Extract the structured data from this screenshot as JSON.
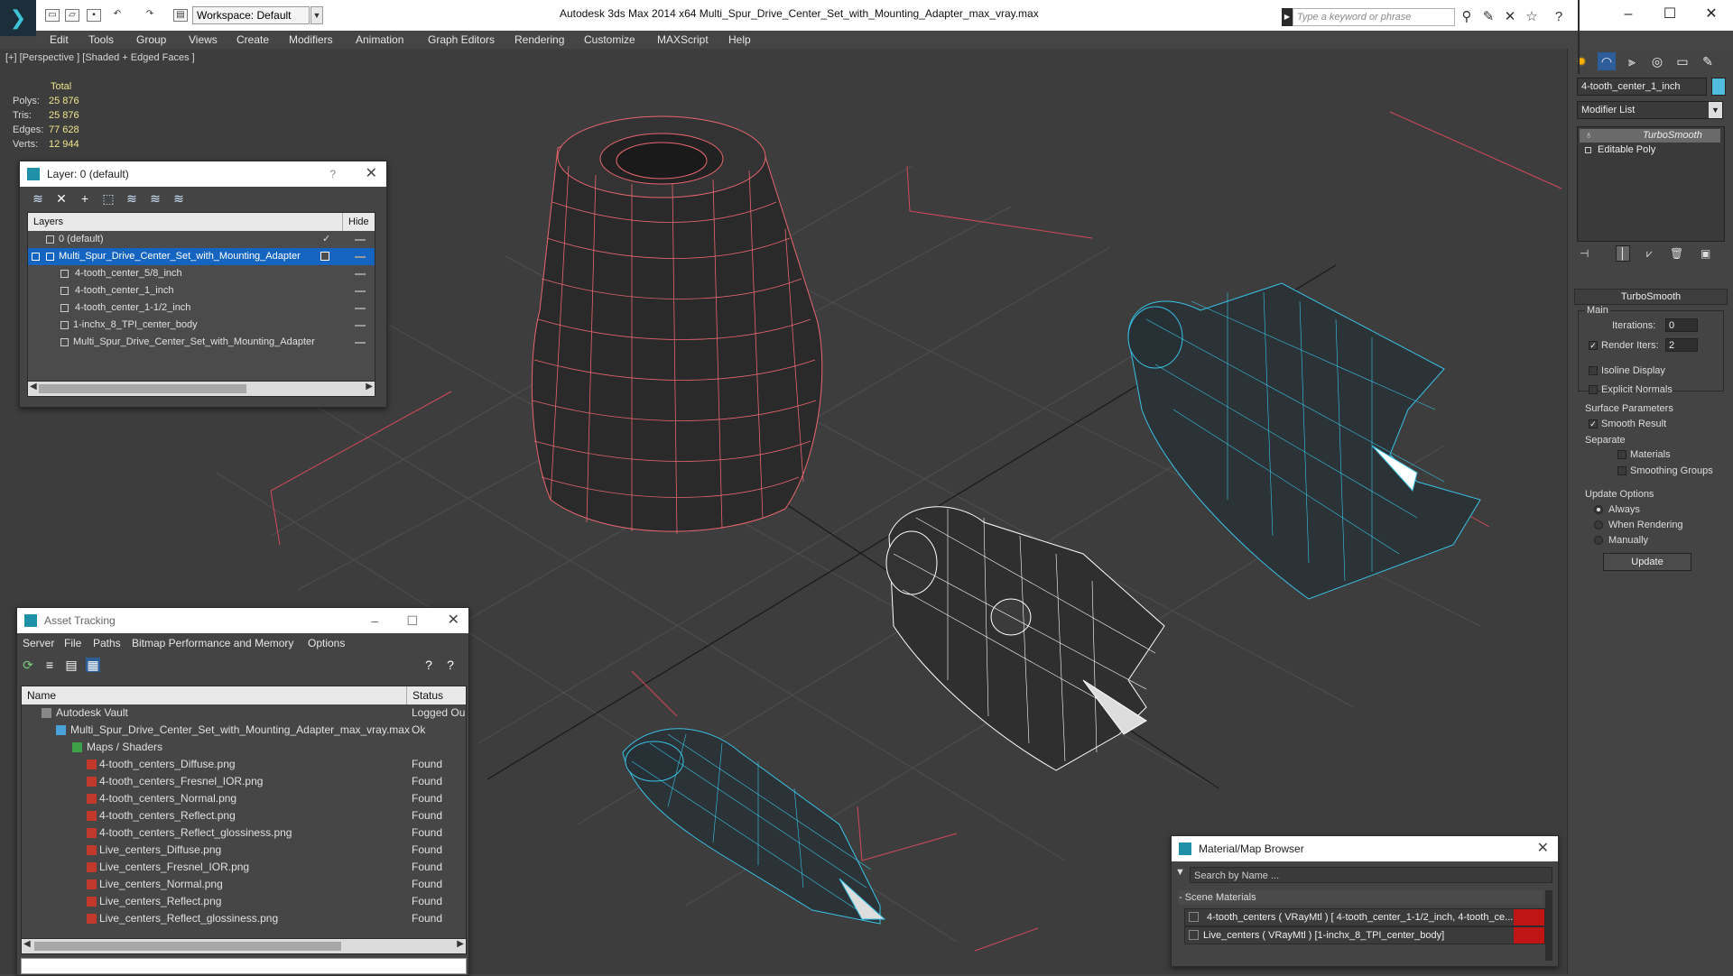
{
  "titlebar": {
    "workspace": "Workspace: Default",
    "title": "Autodesk 3ds Max  2014 x64     Multi_Spur_Drive_Center_Set_with_Mounting_Adapter_max_vray.max",
    "search_placeholder": "Type a keyword or phrase"
  },
  "menu": [
    "Edit",
    "Tools",
    "Group",
    "Views",
    "Create",
    "Modifiers",
    "Animation",
    "Graph Editors",
    "Rendering",
    "Customize",
    "MAXScript",
    "Help"
  ],
  "viewport": {
    "label": "[+] [Perspective ] [Shaded + Edged Faces ]",
    "stats": {
      "header": "Total",
      "rows": [
        {
          "label": "Polys:",
          "value": "25 876"
        },
        {
          "label": "Tris:",
          "value": "25 876"
        },
        {
          "label": "Edges:",
          "value": "77 628"
        },
        {
          "label": "Verts:",
          "value": "12 944"
        }
      ]
    }
  },
  "layer_dialog": {
    "title": "Layer: 0 (default)",
    "help": "?",
    "col_layers": "Layers",
    "col_hide": "Hide",
    "rows": [
      {
        "name": "0 (default)"
      },
      {
        "name": "Multi_Spur_Drive_Center_Set_with_Mounting_Adapter"
      },
      {
        "name": "4-tooth_center_5/8_inch"
      },
      {
        "name": "4-tooth_center_1_inch"
      },
      {
        "name": "4-tooth_center_1-1/2_inch"
      },
      {
        "name": "1-inchx_8_TPI_center_body"
      },
      {
        "name": "Multi_Spur_Drive_Center_Set_with_Mounting_Adapter"
      }
    ]
  },
  "asset_dialog": {
    "title": "Asset Tracking",
    "menu": [
      "Server",
      "File",
      "Paths",
      "Bitmap Performance and Memory",
      "Options"
    ],
    "col_name": "Name",
    "col_status": "Status",
    "rows": [
      {
        "name": "Autodesk Vault",
        "status": "Logged Ou"
      },
      {
        "name": "Multi_Spur_Drive_Center_Set_with_Mounting_Adapter_max_vray.max",
        "status": "Ok"
      },
      {
        "name": "Maps / Shaders",
        "status": ""
      },
      {
        "name": "4-tooth_centers_Diffuse.png",
        "status": "Found"
      },
      {
        "name": "4-tooth_centers_Fresnel_IOR.png",
        "status": "Found"
      },
      {
        "name": "4-tooth_centers_Normal.png",
        "status": "Found"
      },
      {
        "name": "4-tooth_centers_Reflect.png",
        "status": "Found"
      },
      {
        "name": "4-tooth_centers_Reflect_glossiness.png",
        "status": "Found"
      },
      {
        "name": "Live_centers_Diffuse.png",
        "status": "Found"
      },
      {
        "name": "Live_centers_Fresnel_IOR.png",
        "status": "Found"
      },
      {
        "name": "Live_centers_Normal.png",
        "status": "Found"
      },
      {
        "name": "Live_centers_Reflect.png",
        "status": "Found"
      },
      {
        "name": "Live_centers_Reflect_glossiness.png",
        "status": "Found"
      }
    ]
  },
  "material_browser": {
    "title": "Material/Map Browser",
    "search": "Search by Name ...",
    "section": "- Scene Materials",
    "rows": [
      {
        "label": "4-tooth_centers  ( VRayMtl )  [ 4-tooth_center_1-1/2_inch,  4-tooth_ce..."
      },
      {
        "label": "Live_centers  ( VRayMtl )  [1-inchx_8_TPI_center_body]"
      }
    ]
  },
  "command_panel": {
    "object_name": "4-tooth_center_1_inch",
    "object_color": "#52bde0",
    "modifier_list": "Modifier List",
    "stack": [
      "TurboSmooth",
      "Editable Poly"
    ],
    "rollout": "TurboSmooth",
    "main": "Main",
    "iterations_label": "Iterations:",
    "iterations": "0",
    "render_iters_label": "Render Iters:",
    "render_iters": "2",
    "isoline": "Isoline Display",
    "explicit_normals": "Explicit Normals",
    "surface_params": "Surface Parameters",
    "smooth_result": "Smooth Result",
    "separate": "Separate",
    "materials": "Materials",
    "smoothing_groups": "Smoothing Groups",
    "update_options": "Update Options",
    "always": "Always",
    "when_rendering": "When Rendering",
    "manually": "Manually",
    "update": "Update"
  },
  "colors": {
    "wire_red": "#e8676e",
    "wire_cyan": "#39c2e6",
    "wire_white": "#ffffff",
    "selection_blue": "#1565c0"
  }
}
